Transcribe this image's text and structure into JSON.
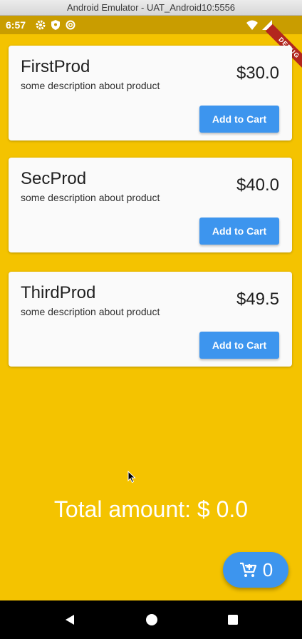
{
  "window": {
    "title": "Android Emulator - UAT_Android10:5556"
  },
  "status_bar": {
    "time": "6:57",
    "debug_label": "DEBUG"
  },
  "products": [
    {
      "name": "FirstProd",
      "description": "some description about product",
      "price": "$30.0",
      "button_label": "Add to Cart"
    },
    {
      "name": "SecProd",
      "description": "some description about product",
      "price": "$40.0",
      "button_label": "Add to Cart"
    },
    {
      "name": "ThirdProd",
      "description": "some description about product",
      "price": "$49.5",
      "button_label": "Add to Cart"
    }
  ],
  "total": {
    "label": "Total amount: $ 0.0"
  },
  "cart_fab": {
    "count": "0",
    "icon": "add-shopping-cart-icon"
  },
  "nav_bar": {
    "icons": [
      "back-icon",
      "home-icon",
      "recents-icon"
    ]
  },
  "colors": {
    "background": "#f4c300",
    "accent": "#3d95ee",
    "card": "#fafafa"
  }
}
